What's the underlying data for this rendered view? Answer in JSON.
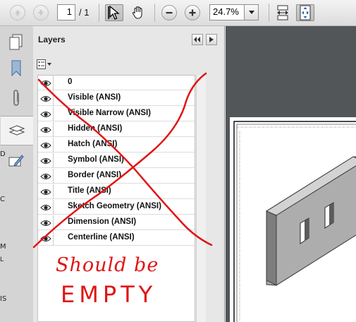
{
  "toolbar": {
    "page_current": "1",
    "page_total_label": "/ 1",
    "zoom_value": "24.7%",
    "icons": [
      "prev-page-icon",
      "next-page-icon",
      "select-tool-icon",
      "hand-tool-icon",
      "zoom-out-icon",
      "zoom-in-icon",
      "fit-width-icon",
      "fit-page-icon"
    ]
  },
  "sidebar": {
    "icons": [
      "pages-icon",
      "bookmarks-icon",
      "attachments-icon",
      "layers-icon",
      "signatures-icon"
    ],
    "edge_chars": [
      "D",
      "C",
      "M",
      "L",
      "IS"
    ]
  },
  "layers_panel": {
    "title": "Layers",
    "layers": [
      {
        "name": "0"
      },
      {
        "name": "Visible (ANSI)"
      },
      {
        "name": "Visible Narrow (ANSI)"
      },
      {
        "name": "Hidden (ANSI)"
      },
      {
        "name": "Hatch (ANSI)"
      },
      {
        "name": "Symbol (ANSI)"
      },
      {
        "name": "Border (ANSI)"
      },
      {
        "name": "Title (ANSI)"
      },
      {
        "name": "Sketch Geometry (ANSI)"
      },
      {
        "name": "Dimension (ANSI)"
      },
      {
        "name": "Centerline (ANSI)"
      }
    ]
  },
  "annotation": {
    "line1": "Should be",
    "line2": "EMPTY",
    "color": "#e01515"
  }
}
